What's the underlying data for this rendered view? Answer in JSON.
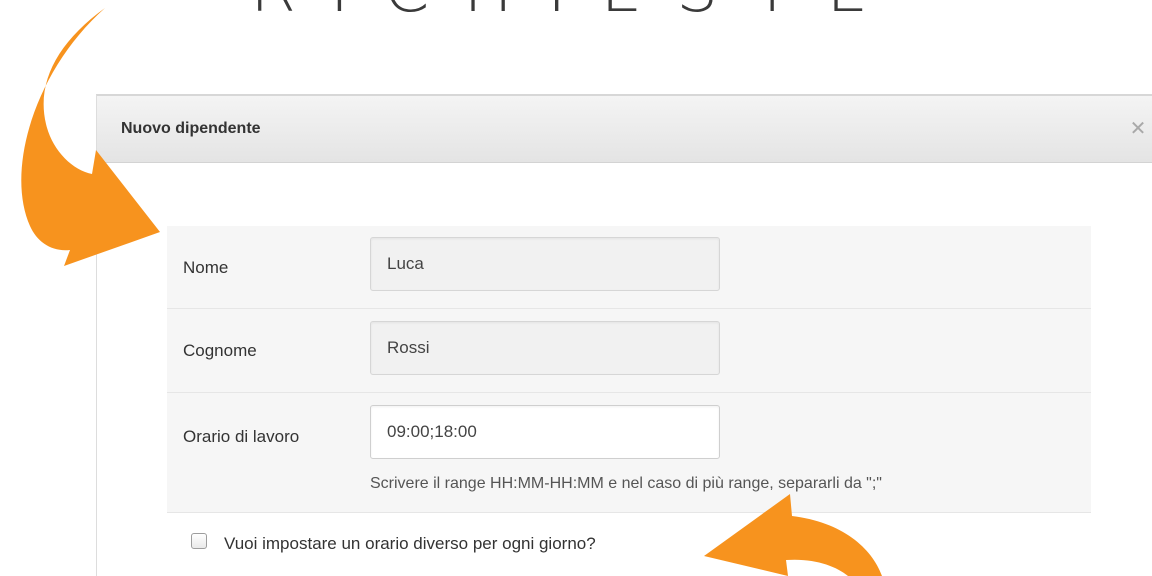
{
  "banner": {
    "title": "RICHIESTE"
  },
  "dialog": {
    "title": "Nuovo dipendente",
    "close_icon": "close-icon",
    "close_glyph": "✕"
  },
  "form": {
    "nome": {
      "label": "Nome",
      "value": "Luca"
    },
    "cognome": {
      "label": "Cognome",
      "value": "Rossi"
    },
    "orario": {
      "label": "Orario di lavoro",
      "value": "09:00;18:00",
      "help": "Scrivere il range HH:MM-HH:MM e nel caso di più range, separarli da \";\""
    },
    "orario_diverso": {
      "label": "Vuoi impostare un orario diverso per ogni giorno?",
      "checked": false
    }
  },
  "colors": {
    "accent_arrow": "#f7931e",
    "header_bg": "#e9e9e9",
    "row_bg": "#f6f6f6"
  }
}
